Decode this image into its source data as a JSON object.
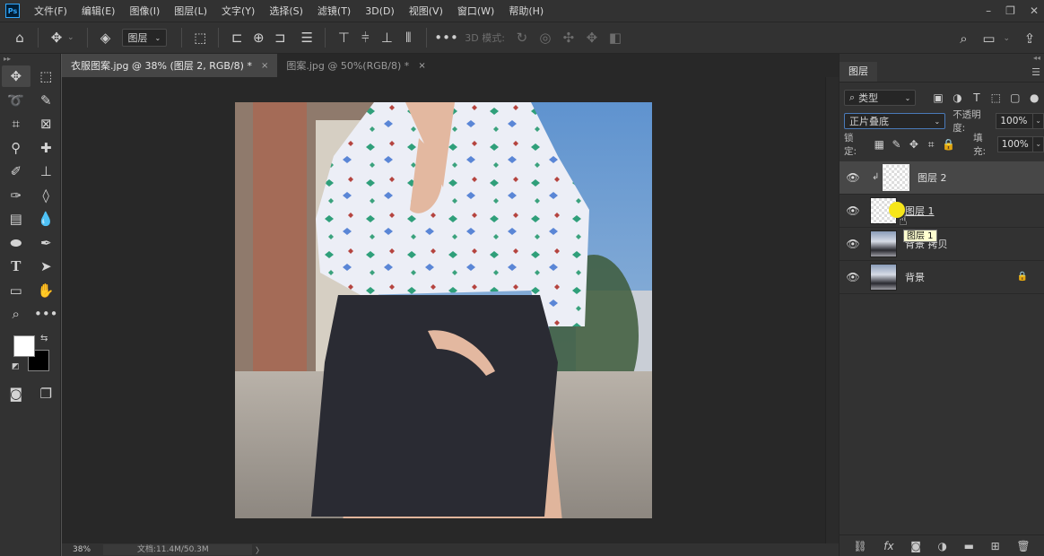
{
  "app": {
    "logo": "Ps"
  },
  "menu": [
    "文件(F)",
    "编辑(E)",
    "图像(I)",
    "图层(L)",
    "文字(Y)",
    "选择(S)",
    "滤镜(T)",
    "3D(D)",
    "视图(V)",
    "窗口(W)",
    "帮助(H)"
  ],
  "window_controls": {
    "minimize": "–",
    "restore": "❐",
    "close": "✕"
  },
  "options_bar": {
    "layer_select": "图层",
    "mode3d_label": "3D 模式:"
  },
  "tabs": [
    {
      "label": "衣服图案.jpg @ 38% (图层 2, RGB/8) *",
      "close": "×"
    },
    {
      "label": "图案.jpg @ 50%(RGB/8) *",
      "close": "×"
    }
  ],
  "status": {
    "zoom": "38%",
    "doc_info": "文档:11.4M/50.3M",
    "arrow": "〉"
  },
  "layers_panel": {
    "tab": "图层",
    "filter_kind": "类型",
    "blend_mode": "正片叠底",
    "opacity_label": "不透明度:",
    "opacity_value": "100%",
    "lock_label": "锁定:",
    "fill_label": "填充:",
    "fill_value": "100%",
    "layers": [
      {
        "name": "图层 2",
        "selected": true,
        "clipped": true,
        "locked": false
      },
      {
        "name": "图层 1",
        "selected": false,
        "clipped": false,
        "locked": false
      },
      {
        "name": "背景 拷贝",
        "selected": false,
        "clipped": false,
        "locked": false
      },
      {
        "name": "背景",
        "selected": false,
        "clipped": false,
        "locked": true
      }
    ],
    "drag_tooltip": "图层 1"
  },
  "colors": {
    "accent": "#31a8ff",
    "foreground": "#ffffff",
    "background": "#000000",
    "drag_dot": "#f6e61a"
  },
  "icons": {
    "toolbar": [
      "move-icon",
      "marquee-icon",
      "lasso-icon",
      "quick-select-icon",
      "crop-icon",
      "frame-icon",
      "eyedropper-icon",
      "healing-icon",
      "brush-icon",
      "stamp-icon",
      "history-brush-icon",
      "eraser-icon",
      "gradient-icon",
      "blur-icon",
      "dodge-icon",
      "pen-icon",
      "type-icon",
      "path-select-icon",
      "rectangle-icon",
      "hand-icon",
      "zoom-icon",
      "more-icon"
    ]
  }
}
